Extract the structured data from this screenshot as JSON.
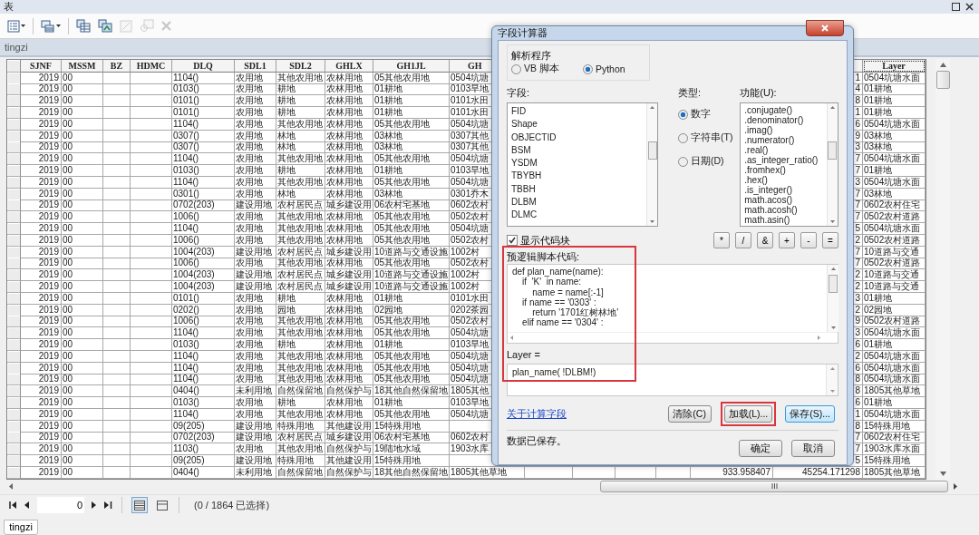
{
  "window": {
    "title": "表"
  },
  "toolbar": [
    {
      "kind": "table-options",
      "disabled": false
    },
    {
      "kind": "related-tables",
      "disabled": false
    },
    {
      "kind": "select-by-attributes",
      "disabled": false
    },
    {
      "kind": "switch-selection",
      "disabled": false
    },
    {
      "kind": "clear-selection",
      "disabled": true
    },
    {
      "kind": "zoom-selected",
      "disabled": true
    },
    {
      "kind": "delete",
      "disabled": true
    }
  ],
  "table_tab": "tingzi",
  "table": {
    "columns": [
      {
        "label": "SJNF",
        "focused": false
      },
      {
        "label": "MSSM",
        "focused": false
      },
      {
        "label": "BZ",
        "focused": false
      },
      {
        "label": "HDMC",
        "focused": false
      },
      {
        "label": "DLQ",
        "focused": false
      },
      {
        "label": "SDL1",
        "focused": false
      },
      {
        "label": "SDL2",
        "focused": false
      },
      {
        "label": "GHLX",
        "focused": false
      },
      {
        "label": "GH1JL",
        "focused": false
      },
      {
        "label": "GH",
        "focused": false
      },
      {
        "label": "Layer",
        "focused": true
      }
    ],
    "rows": [
      {
        "sjnf": "2019",
        "mssm": "00",
        "dlq": "1104()",
        "sdl1": "农用地",
        "sdl2": "其他农用地",
        "ghlx": "农林用地",
        "gh1jl": "05其他农用地",
        "gh2": "0504坑塘",
        "column_16": "1",
        "layer": "0504坑塘水面"
      },
      {
        "sjnf": "2019",
        "mssm": "00",
        "dlq": "0103()",
        "sdl1": "农用地",
        "sdl2": "耕地",
        "ghlx": "农林用地",
        "gh1jl": "01耕地",
        "gh2": "0103旱地",
        "column_16": "4",
        "layer": "01耕地"
      },
      {
        "sjnf": "2019",
        "mssm": "00",
        "dlq": "0101()",
        "sdl1": "农用地",
        "sdl2": "耕地",
        "ghlx": "农林用地",
        "gh1jl": "01耕地",
        "gh2": "0101水田",
        "column_16": "8",
        "layer": "01耕地"
      },
      {
        "sjnf": "2019",
        "mssm": "00",
        "dlq": "0101()",
        "sdl1": "农用地",
        "sdl2": "耕地",
        "ghlx": "农林用地",
        "gh1jl": "01耕地",
        "gh2": "0101水田",
        "column_16": "1",
        "layer": "01耕地"
      },
      {
        "sjnf": "2019",
        "mssm": "00",
        "dlq": "1104()",
        "sdl1": "农用地",
        "sdl2": "其他农用地",
        "ghlx": "农林用地",
        "gh1jl": "05其他农用地",
        "gh2": "0504坑塘",
        "column_16": "6",
        "layer": "0504坑塘水面"
      },
      {
        "sjnf": "2019",
        "mssm": "00",
        "dlq": "0307()",
        "sdl1": "农用地",
        "sdl2": "林地",
        "ghlx": "农林用地",
        "gh1jl": "03林地",
        "gh2": "0307其他",
        "column_16": "9",
        "layer": "03林地"
      },
      {
        "sjnf": "2019",
        "mssm": "00",
        "dlq": "0307()",
        "sdl1": "农用地",
        "sdl2": "林地",
        "ghlx": "农林用地",
        "gh1jl": "03林地",
        "gh2": "0307其他",
        "column_16": "3",
        "layer": "03林地"
      },
      {
        "sjnf": "2019",
        "mssm": "00",
        "dlq": "1104()",
        "sdl1": "农用地",
        "sdl2": "其他农用地",
        "ghlx": "农林用地",
        "gh1jl": "05其他农用地",
        "gh2": "0504坑塘",
        "column_16": "7",
        "layer": "0504坑塘水面"
      },
      {
        "sjnf": "2019",
        "mssm": "00",
        "dlq": "0103()",
        "sdl1": "农用地",
        "sdl2": "耕地",
        "ghlx": "农林用地",
        "gh1jl": "01耕地",
        "gh2": "0103旱地",
        "column_16": "7",
        "layer": "01耕地"
      },
      {
        "sjnf": "2019",
        "mssm": "00",
        "dlq": "1104()",
        "sdl1": "农用地",
        "sdl2": "其他农用地",
        "ghlx": "农林用地",
        "gh1jl": "05其他农用地",
        "gh2": "0504坑塘",
        "column_16": "3",
        "layer": "0504坑塘水面"
      },
      {
        "sjnf": "2019",
        "mssm": "00",
        "dlq": "0301()",
        "sdl1": "农用地",
        "sdl2": "林地",
        "ghlx": "农林用地",
        "gh1jl": "03林地",
        "gh2": "0301乔木",
        "column_16": "7",
        "layer": "03林地"
      },
      {
        "sjnf": "2019",
        "mssm": "00",
        "dlq": "0702(203)",
        "sdl1": "建设用地",
        "sdl2": "农村居民点",
        "ghlx": "城乡建设用",
        "gh1jl": "06农村宅基地",
        "gh2": "0602农村",
        "column_16": "7",
        "layer": "0602农村住宅"
      },
      {
        "sjnf": "2019",
        "mssm": "00",
        "dlq": "1006()",
        "sdl1": "农用地",
        "sdl2": "其他农用地",
        "ghlx": "农林用地",
        "gh1jl": "05其他农用地",
        "gh2": "0502农村",
        "column_16": "7",
        "layer": "0502农村道路"
      },
      {
        "sjnf": "2019",
        "mssm": "00",
        "dlq": "1104()",
        "sdl1": "农用地",
        "sdl2": "其他农用地",
        "ghlx": "农林用地",
        "gh1jl": "05其他农用地",
        "gh2": "0504坑塘",
        "column_16": "5",
        "layer": "0504坑塘水面"
      },
      {
        "sjnf": "2019",
        "mssm": "00",
        "dlq": "1006()",
        "sdl1": "农用地",
        "sdl2": "其他农用地",
        "ghlx": "农林用地",
        "gh1jl": "05其他农用地",
        "gh2": "0502农村",
        "column_16": "2",
        "layer": "0502农村道路"
      },
      {
        "sjnf": "2019",
        "mssm": "00",
        "dlq": "1004(203)",
        "sdl1": "建设用地",
        "sdl2": "农村居民点",
        "ghlx": "城乡建设用",
        "gh1jl": "10道路与交通设施",
        "gh2": "1002村",
        "column_16": "7",
        "layer": "10道路与交通"
      },
      {
        "sjnf": "2019",
        "mssm": "00",
        "dlq": "1006()",
        "sdl1": "农用地",
        "sdl2": "其他农用地",
        "ghlx": "农林用地",
        "gh1jl": "05其他农用地",
        "gh2": "0502农村",
        "column_16": "7",
        "layer": "0502农村道路"
      },
      {
        "sjnf": "2019",
        "mssm": "00",
        "dlq": "1004(203)",
        "sdl1": "建设用地",
        "sdl2": "农村居民点",
        "ghlx": "城乡建设用",
        "gh1jl": "10道路与交通设施",
        "gh2": "1002村",
        "column_16": "2",
        "layer": "10道路与交通"
      },
      {
        "sjnf": "2019",
        "mssm": "00",
        "dlq": "1004(203)",
        "sdl1": "建设用地",
        "sdl2": "农村居民点",
        "ghlx": "城乡建设用",
        "gh1jl": "10道路与交通设施",
        "gh2": "1002村",
        "column_16": "2",
        "layer": "10道路与交通"
      },
      {
        "sjnf": "2019",
        "mssm": "00",
        "dlq": "0101()",
        "sdl1": "农用地",
        "sdl2": "耕地",
        "ghlx": "农林用地",
        "gh1jl": "01耕地",
        "gh2": "0101水田",
        "column_16": "3",
        "layer": "01耕地"
      },
      {
        "sjnf": "2019",
        "mssm": "00",
        "dlq": "0202()",
        "sdl1": "农用地",
        "sdl2": "园地",
        "ghlx": "农林用地",
        "gh1jl": "02园地",
        "gh2": "0202茶园",
        "column_16": "2",
        "layer": "02园地"
      },
      {
        "sjnf": "2019",
        "mssm": "00",
        "dlq": "1006()",
        "sdl1": "农用地",
        "sdl2": "其他农用地",
        "ghlx": "农林用地",
        "gh1jl": "05其他农用地",
        "gh2": "0502农村",
        "column_16": "9",
        "layer": "0502农村道路"
      },
      {
        "sjnf": "2019",
        "mssm": "00",
        "dlq": "1104()",
        "sdl1": "农用地",
        "sdl2": "其他农用地",
        "ghlx": "农林用地",
        "gh1jl": "05其他农用地",
        "gh2": "0504坑塘",
        "column_16": "3",
        "layer": "0504坑塘水面"
      },
      {
        "sjnf": "2019",
        "mssm": "00",
        "dlq": "0103()",
        "sdl1": "农用地",
        "sdl2": "耕地",
        "ghlx": "农林用地",
        "gh1jl": "01耕地",
        "gh2": "0103旱地",
        "column_16": "6",
        "layer": "01耕地"
      },
      {
        "sjnf": "2019",
        "mssm": "00",
        "dlq": "1104()",
        "sdl1": "农用地",
        "sdl2": "其他农用地",
        "ghlx": "农林用地",
        "gh1jl": "05其他农用地",
        "gh2": "0504坑塘",
        "column_16": "2",
        "layer": "0504坑塘水面"
      },
      {
        "sjnf": "2019",
        "mssm": "00",
        "dlq": "1104()",
        "sdl1": "农用地",
        "sdl2": "其他农用地",
        "ghlx": "农林用地",
        "gh1jl": "05其他农用地",
        "gh2": "0504坑塘",
        "column_16": "6",
        "layer": "0504坑塘水面"
      },
      {
        "sjnf": "2019",
        "mssm": "00",
        "dlq": "1104()",
        "sdl1": "农用地",
        "sdl2": "其他农用地",
        "ghlx": "农林用地",
        "gh1jl": "05其他农用地",
        "gh2": "0504坑塘",
        "column_16": "8",
        "layer": "0504坑塘水面"
      },
      {
        "sjnf": "2019",
        "mssm": "00",
        "dlq": "0404()",
        "sdl1": "未利用地",
        "sdl2": "自然保留地",
        "ghlx": "自然保护与",
        "gh1jl": "18其他自然保留地",
        "gh2": "1805其他",
        "column_16": "8",
        "layer": "1805其他草地"
      },
      {
        "sjnf": "2019",
        "mssm": "00",
        "dlq": "0103()",
        "sdl1": "农用地",
        "sdl2": "耕地",
        "ghlx": "农林用地",
        "gh1jl": "01耕地",
        "gh2": "0103旱地",
        "column_16": "6",
        "layer": "01耕地"
      },
      {
        "sjnf": "2019",
        "mssm": "00",
        "dlq": "1104()",
        "sdl1": "农用地",
        "sdl2": "其他农用地",
        "ghlx": "农林用地",
        "gh1jl": "05其他农用地",
        "gh2": "0504坑塘",
        "column_16": "1",
        "layer": "0504坑塘水面"
      },
      {
        "sjnf": "2019",
        "mssm": "00",
        "dlq": "09(205)",
        "sdl1": "建设用地",
        "sdl2": "特殊用地",
        "ghlx": "其他建设用",
        "gh1jl": "15特殊用地",
        "column_16": "8",
        "layer": "15特殊用地"
      },
      {
        "sjnf": "2019",
        "mssm": "00",
        "dlq": "0702(203)",
        "sdl1": "建设用地",
        "sdl2": "农村居民点",
        "ghlx": "城乡建设用",
        "gh1jl": "06农村宅基地",
        "gh2": "0602农村",
        "column_16": "7",
        "layer": "0602农村住宅"
      },
      {
        "sjnf": "2019",
        "mssm": "00",
        "dlq": "1103()",
        "sdl1": "农用地",
        "sdl2": "其他农用地",
        "ghlx": "自然保护与",
        "gh1jl": "19陆地水域",
        "gh2": "1903水库",
        "column_16": "7",
        "layer": "1903水库水面"
      },
      {
        "sjnf": "2019",
        "mssm": "00",
        "dlq": "09(205)",
        "sdl1": "建设用地",
        "sdl2": "特殊用地",
        "ghlx": "其他建设用",
        "gh1jl": "15特殊用地",
        "column_16": "5",
        "layer": "15特殊用地"
      },
      {
        "sjnf": "2019",
        "mssm": "00",
        "dlq": "0404()",
        "sdl1": "未利用地",
        "sdl2": "自然保留地",
        "ghlx": "自然保护与",
        "gh1jl": "18其他自然保留地",
        "gh2": "1805其他草地",
        "column_15": "933.958407",
        "column_16": "45254.171298",
        "layer": "1805其他草地"
      }
    ]
  },
  "navigator": {
    "record": "0",
    "views": [
      {
        "selected": true
      },
      {
        "selected": false
      }
    ],
    "selection": "(0 / 1864 已选择)"
  },
  "bottom_tab": "tingzi",
  "dialog": {
    "title": "字段计算器",
    "parser": {
      "label": "解析程序",
      "options": [
        {
          "label": "VB 脚本",
          "selected": false
        },
        {
          "label": "Python",
          "selected": true
        }
      ]
    },
    "fields": {
      "label": "字段:",
      "items": [
        "FID",
        "Shape",
        "OBJECTID",
        "BSM",
        "YSDM",
        "TBYBH",
        "TBBH",
        "DLBM",
        "DLMC"
      ]
    },
    "type": {
      "label": "类型:",
      "options": [
        {
          "label": "数字",
          "selected": true
        },
        {
          "label": "字符串(T)",
          "selected": false
        },
        {
          "label": "日期(D)",
          "selected": false
        }
      ]
    },
    "functions": {
      "label": "功能(U):",
      "items": [
        ".conjugate()",
        ".denominator()",
        ".imag()",
        ".numerator()",
        ".real()",
        ".as_integer_ratio()",
        ".fromhex()",
        ".hex()",
        ".is_integer()",
        "math.acos()",
        "math.acosh()",
        "math.asin()"
      ]
    },
    "show_codeblock": {
      "label": "显示代码块",
      "checked": true
    },
    "operators": [
      "*",
      "/",
      "&",
      "+",
      "-",
      "="
    ],
    "codeblock": {
      "label": "预逻辑脚本代码:",
      "highlighted": true,
      "lines": [
        "def plan_name(name):",
        "    if  'K'  in name:",
        "        name = name[:-1]",
        "    if name == '0303' :",
        "        return '1701红树林地'",
        "    elif name == '0304' :"
      ]
    },
    "expression": {
      "label": "Layer =",
      "value": "plan_name( !DLBM!)"
    },
    "help_link": "关于计算字段",
    "buttons": [
      {
        "label": "清除(C)",
        "highlighted": false,
        "focused": false
      },
      {
        "label": "加载(L)...",
        "highlighted": true,
        "focused": false
      },
      {
        "label": "保存(S)...",
        "highlighted": false,
        "focused": true
      }
    ],
    "status": "数据已保存。",
    "footer_buttons": [
      "确定",
      "取消"
    ]
  }
}
